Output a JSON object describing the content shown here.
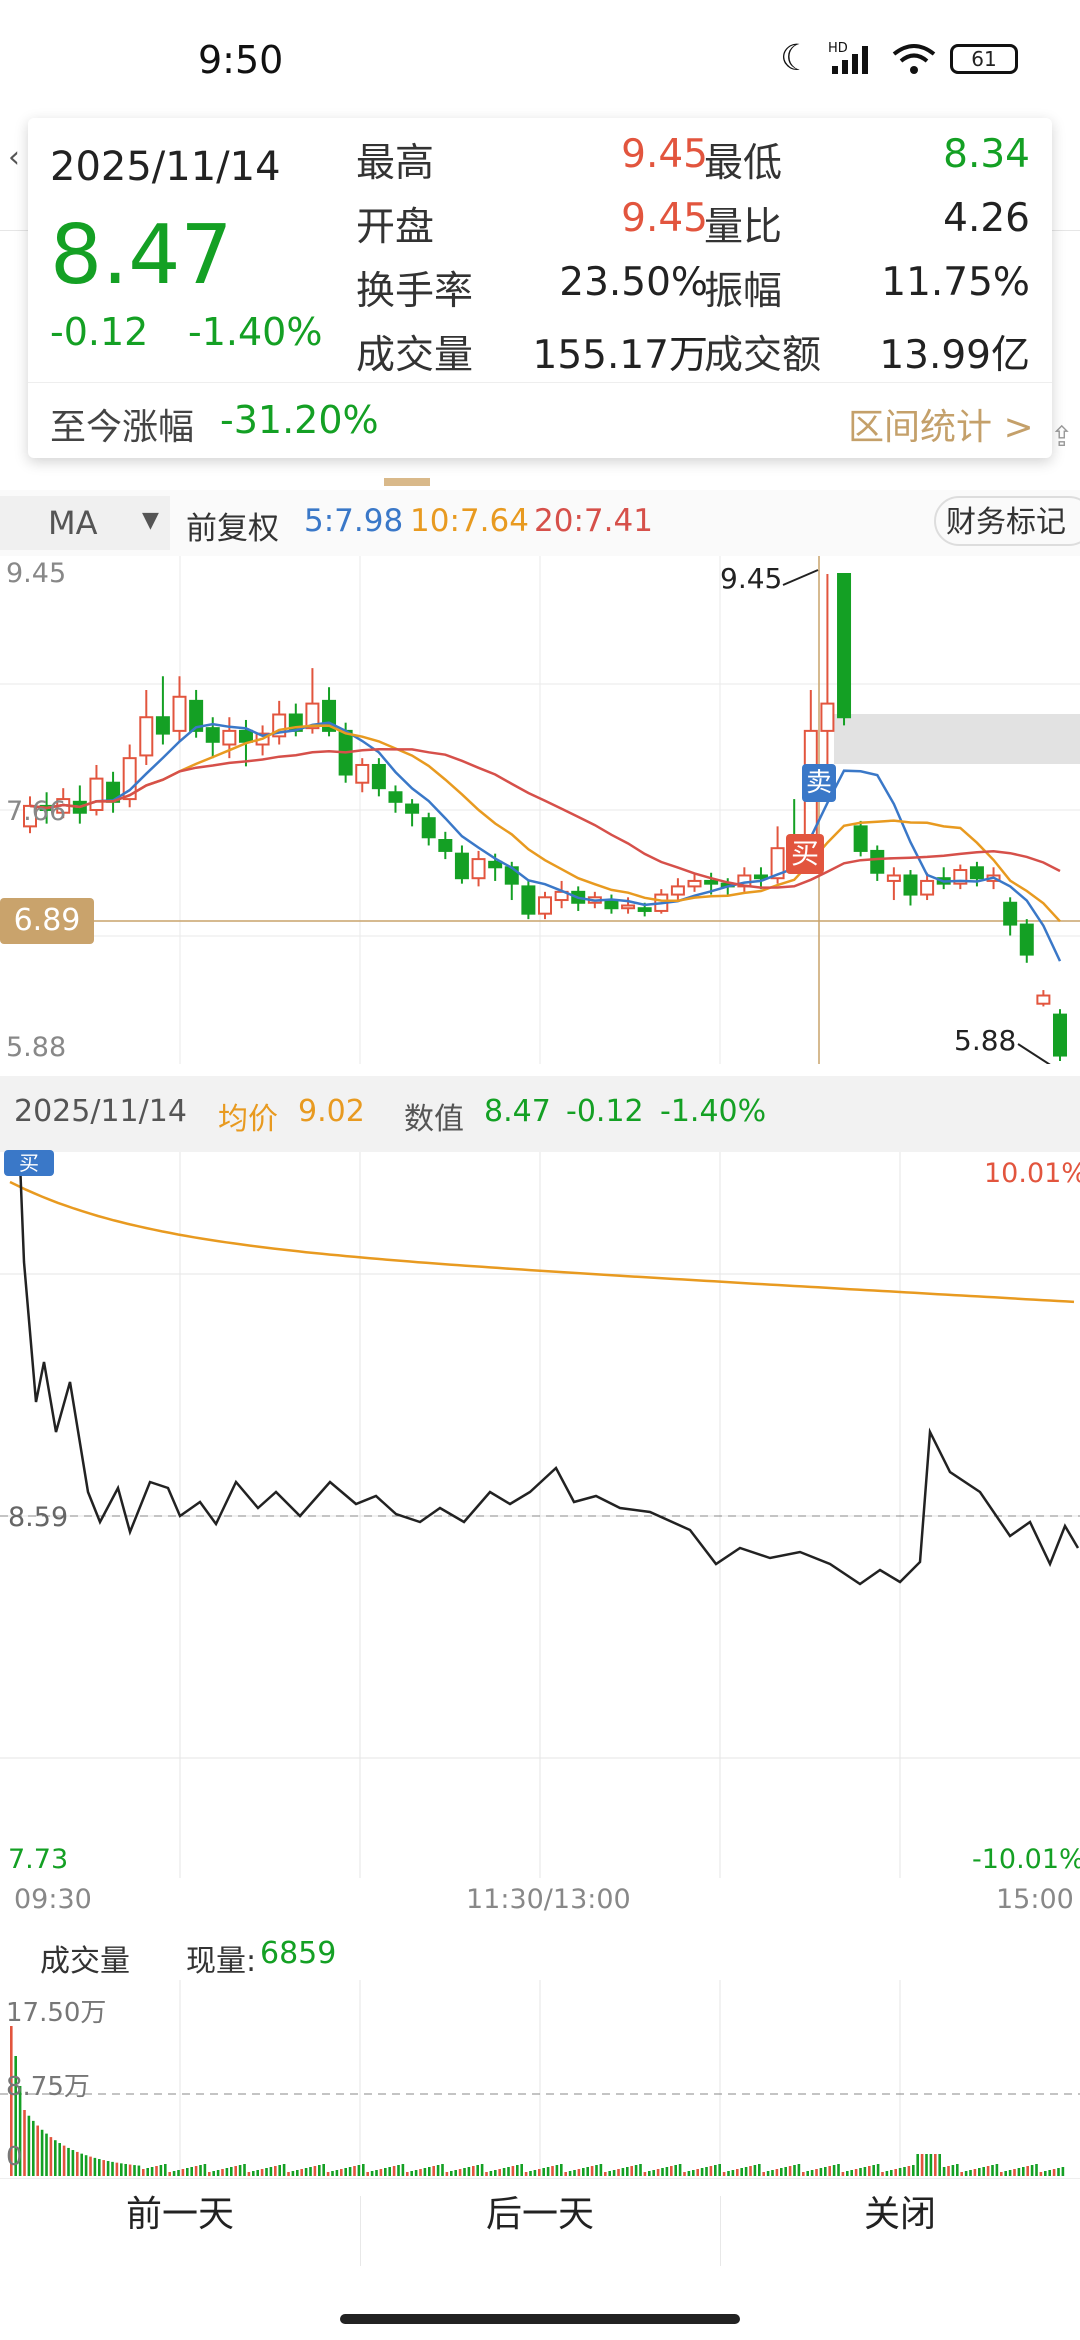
{
  "status": {
    "time": "9:50",
    "battery": "61",
    "network": "HD"
  },
  "card": {
    "date": "2025/11/14",
    "price": "8.47",
    "change": "-0.12",
    "change_pct": "-1.40%",
    "stats": [
      {
        "label": "最高",
        "value": "9.45",
        "color": "red"
      },
      {
        "label": "最低",
        "value": "8.34",
        "color": "green"
      },
      {
        "label": "开盘",
        "value": "9.45",
        "color": "red"
      },
      {
        "label": "量比",
        "value": "4.26",
        "color": "dark"
      },
      {
        "label": "换手率",
        "value": "23.50%",
        "color": "dark"
      },
      {
        "label": "振幅",
        "value": "11.75%",
        "color": "dark"
      },
      {
        "label": "成交量",
        "value": "155.17万",
        "color": "dark"
      },
      {
        "label": "成交额",
        "value": "13.99亿",
        "color": "dark"
      }
    ],
    "since_label": "至今涨幅",
    "since_value": "-31.20%",
    "range_link": "区间统计 >"
  },
  "ma_bar": {
    "selector": "MA",
    "adjust": "前复权",
    "ma5": "5:7.98",
    "ma10": "10:7.64",
    "ma20": "20:7.41",
    "finance_btn": "财务标记"
  },
  "kline": {
    "top_label": "9.45",
    "mid_label": "7.66",
    "low_label": "5.88",
    "cursor_price": "6.89",
    "high_mark": "9.45",
    "low_mark": "5.88",
    "sell_tag": "卖",
    "buy_tag": "买"
  },
  "intraday_header": {
    "date": "2025/11/14",
    "avg_label": "均价",
    "avg_value": "9.02",
    "val_label": "数值",
    "val_price": "8.47",
    "val_change": "-0.12",
    "val_pct": "-1.40%"
  },
  "intraday": {
    "top_pct": "10.01%",
    "mid_price": "8.59",
    "low_price": "7.73",
    "low_pct": "-10.01%",
    "t_start": "09:30",
    "t_mid": "11:30/13:00",
    "t_end": "15:00",
    "buy_tag": "买"
  },
  "volume": {
    "label": "成交量",
    "now_label": "现量:",
    "now_value": "6859",
    "y_top": "17.50万",
    "y_mid": "8.75万",
    "y_zero": "0"
  },
  "bottom": {
    "prev": "前一天",
    "next": "后一天",
    "close": "关闭"
  }
}
